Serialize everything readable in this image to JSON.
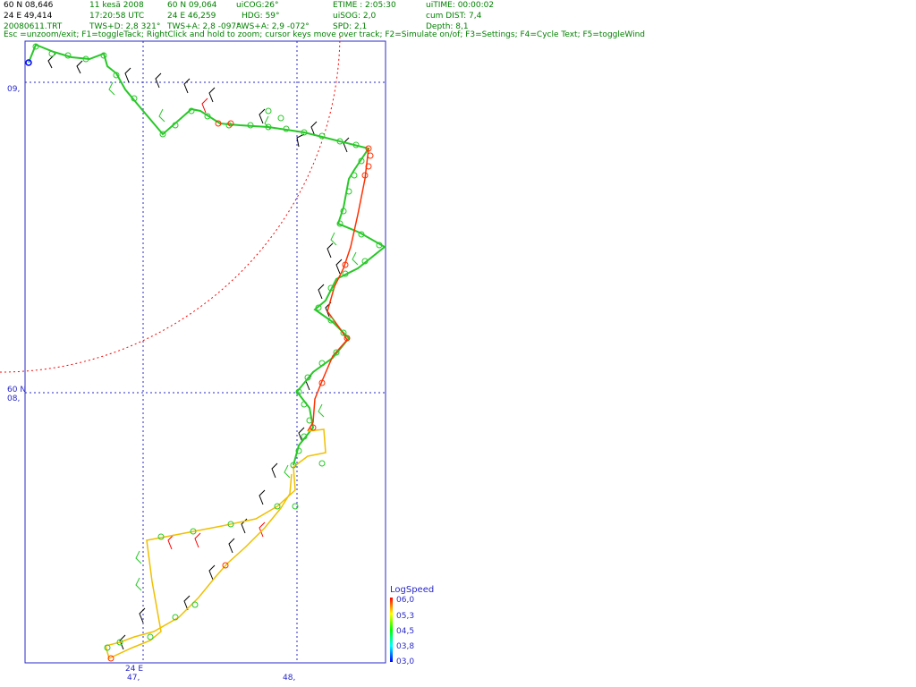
{
  "header": {
    "row1": [
      {
        "id": "lat",
        "text": "60 N 08,646"
      },
      {
        "id": "date",
        "text": "11 kesä 2008"
      },
      {
        "id": "cursor_lat",
        "text": "60 N 09,064"
      },
      {
        "id": "cog",
        "text": "uiCOG:26°"
      },
      {
        "id": "etime",
        "text": "ETIME : 2:05:30"
      },
      {
        "id": "uitime",
        "text": "uiTIME: 00:00:02"
      }
    ],
    "row2": [
      {
        "id": "lon",
        "text": "24 E 49,414"
      },
      {
        "id": "time",
        "text": "17:20:58 UTC"
      },
      {
        "id": "cursor_lon",
        "text": "24 E 46,259"
      },
      {
        "id": "hdg",
        "text": "HDG: 59°"
      },
      {
        "id": "sog",
        "text": "uiSOG: 2,0"
      },
      {
        "id": "dist",
        "text": "cum DIST: 7,4"
      }
    ],
    "row3": [
      {
        "id": "file",
        "text": "20080611.TRT"
      },
      {
        "id": "twsd",
        "text": "TWS+D: 2,8 321°"
      },
      {
        "id": "twsa",
        "text": "TWS+A: 2,8 -097°"
      },
      {
        "id": "awsa",
        "text": "AWS+A: 2,9 -072°"
      },
      {
        "id": "spd",
        "text": "SPD: 2,1"
      },
      {
        "id": "depth",
        "text": "Depth: 8,1"
      }
    ],
    "help": "Esc =unzoom/exit; F1=toggleTack; RightClick and hold to zoom; cursor keys move over track; F2=Simulate on/of; F3=Settings; F4=Cycle Text; F5=toggleWind"
  },
  "grid_labels": {
    "lat_top": "09,",
    "lat_mid_deg": "60 N",
    "lat_mid": "08,",
    "lon_deg": "24 E",
    "lon_left": "47,",
    "lon_right": "48,"
  },
  "legend": {
    "title": "LogSpeed",
    "values": [
      "06,0",
      "05,3",
      "04,5",
      "03,8",
      "03,0"
    ],
    "colors": [
      "#ff0000",
      "#ffff00",
      "#00ff00",
      "#00ffff",
      "#0000ff"
    ]
  },
  "colors": {
    "header_text": "#008000",
    "grid": "#2828c8",
    "range_circle": "#ff0000",
    "track_fast": "#ff3000",
    "track_mid": "#28c828",
    "track_slow": "#ffd000"
  }
}
